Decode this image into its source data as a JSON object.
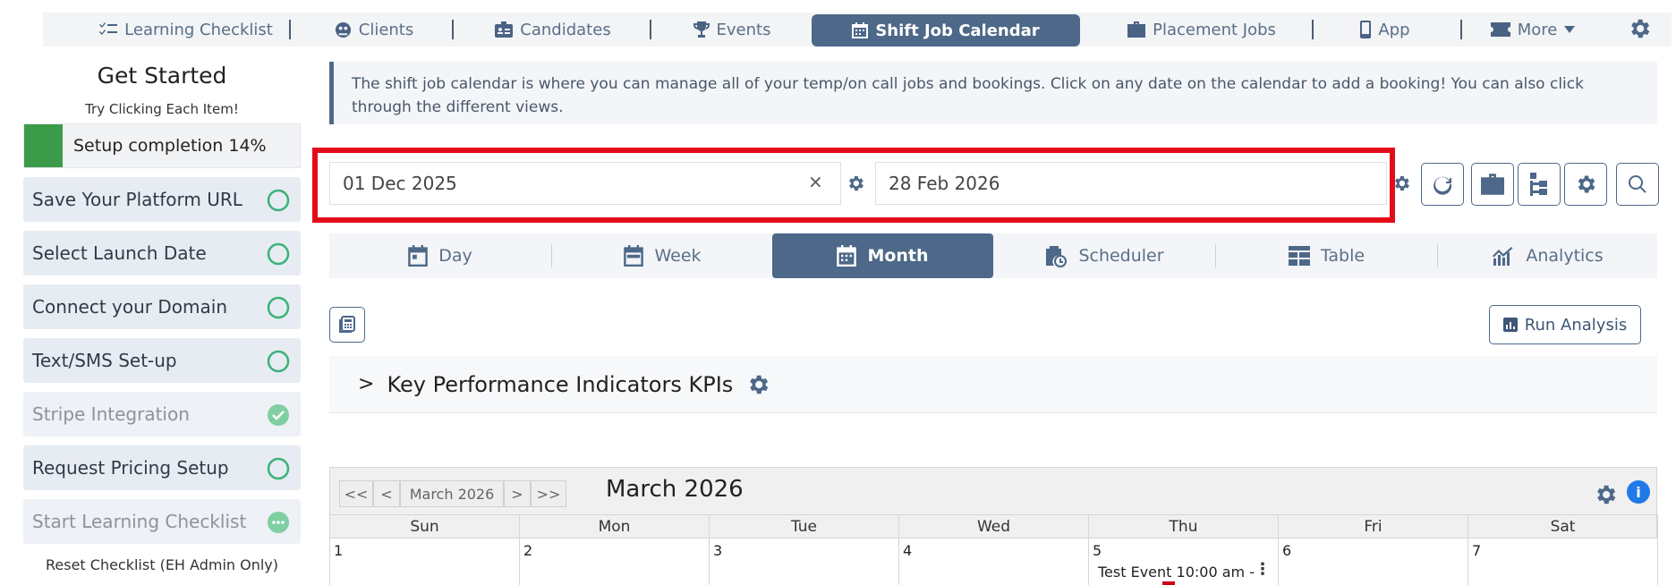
{
  "nav": {
    "items": [
      {
        "label": "Learning Checklist",
        "icon": "checklist-icon"
      },
      {
        "label": "Clients",
        "icon": "clients-icon"
      },
      {
        "label": "Candidates",
        "icon": "id-card-icon"
      },
      {
        "label": "Events",
        "icon": "trophy-icon"
      },
      {
        "label": "Shift Job Calendar",
        "icon": "calendar-icon",
        "active": true
      },
      {
        "label": "Placement Jobs",
        "icon": "briefcase-icon"
      },
      {
        "label": "App",
        "icon": "mobile-icon"
      },
      {
        "label": "More",
        "icon": "ticket-icon"
      }
    ]
  },
  "left": {
    "title": "Get Started",
    "subtitle": "Try Clicking Each Item!",
    "progress_label": "Setup completion 14%",
    "progress_percent": 14,
    "items": [
      {
        "label": "Save Your Platform URL",
        "status": "incomplete"
      },
      {
        "label": "Select Launch Date",
        "status": "incomplete"
      },
      {
        "label": "Connect your Domain",
        "status": "incomplete"
      },
      {
        "label": "Text/SMS Set-up",
        "status": "incomplete"
      },
      {
        "label": "Stripe Integration",
        "status": "complete"
      },
      {
        "label": "Request Pricing Setup",
        "status": "incomplete"
      },
      {
        "label": "Start Learning Checklist",
        "status": "in-progress"
      }
    ],
    "reset": "Reset Checklist (EH Admin Only)"
  },
  "info_text": "The shift job calendar is where you can manage all of your temp/on call jobs and bookings. Click on any date on the calendar to add a booking! You can also click through the different views.",
  "date_range": {
    "start": "01 Dec 2025",
    "end": "28 Feb 2026",
    "clear": "×"
  },
  "view_tabs": [
    {
      "label": "Day",
      "icon": "calendar-day-icon"
    },
    {
      "label": "Week",
      "icon": "calendar-week-icon"
    },
    {
      "label": "Month",
      "icon": "calendar-month-icon",
      "active": true
    },
    {
      "label": "Scheduler",
      "icon": "clipboard-clock-icon"
    },
    {
      "label": "Table",
      "icon": "table-icon"
    },
    {
      "label": "Analytics",
      "icon": "analytics-icon"
    }
  ],
  "run_analysis": "Run Analysis",
  "kpi": {
    "chevron": ">",
    "title": "Key Performance Indicators KPIs"
  },
  "calendar": {
    "nav": {
      "first": "<<",
      "prev": "<",
      "month_label": "March 2026",
      "next": ">",
      "last": ">>"
    },
    "title": "March 2026",
    "info": "i",
    "weekdays": [
      "Sun",
      "Mon",
      "Tue",
      "Wed",
      "Thu",
      "Fri",
      "Sat"
    ],
    "days": [
      "1",
      "2",
      "3",
      "4",
      "5",
      "6",
      "7"
    ],
    "event": {
      "text": "Test Event 10:00 am -",
      "dots": "⋮"
    }
  },
  "colors": {
    "primary": "#4d6888",
    "highlight_box": "#e30d1a",
    "progress": "#3c9b48",
    "check_ring": "#3bb27a",
    "info_blue": "#1f7ae8"
  }
}
